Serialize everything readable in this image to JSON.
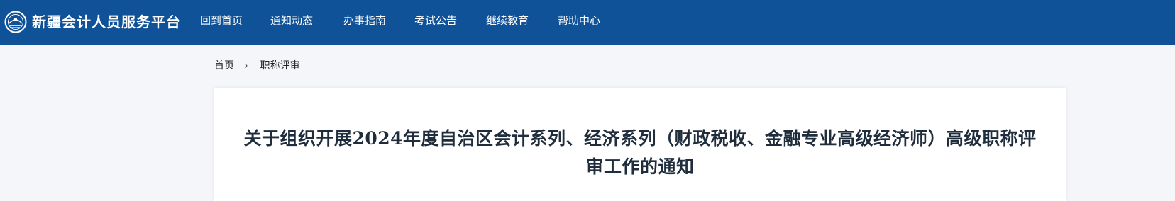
{
  "header": {
    "site_title": "新疆会计人员服务平台",
    "logo_icon": "emblem-icon",
    "bar_color": "#0f5298",
    "nav": [
      {
        "label": "回到首页"
      },
      {
        "label": "通知动态"
      },
      {
        "label": "办事指南"
      },
      {
        "label": "考试公告"
      },
      {
        "label": "继续教育"
      },
      {
        "label": "帮助中心"
      }
    ]
  },
  "breadcrumb": {
    "home": "首页",
    "separator": "›",
    "current": "职称评审"
  },
  "article": {
    "title": "关于组织开展2024年度自治区会计系列、经济系列（财政税收、金融专业高级经济师）高级职称评审工作的通知"
  }
}
